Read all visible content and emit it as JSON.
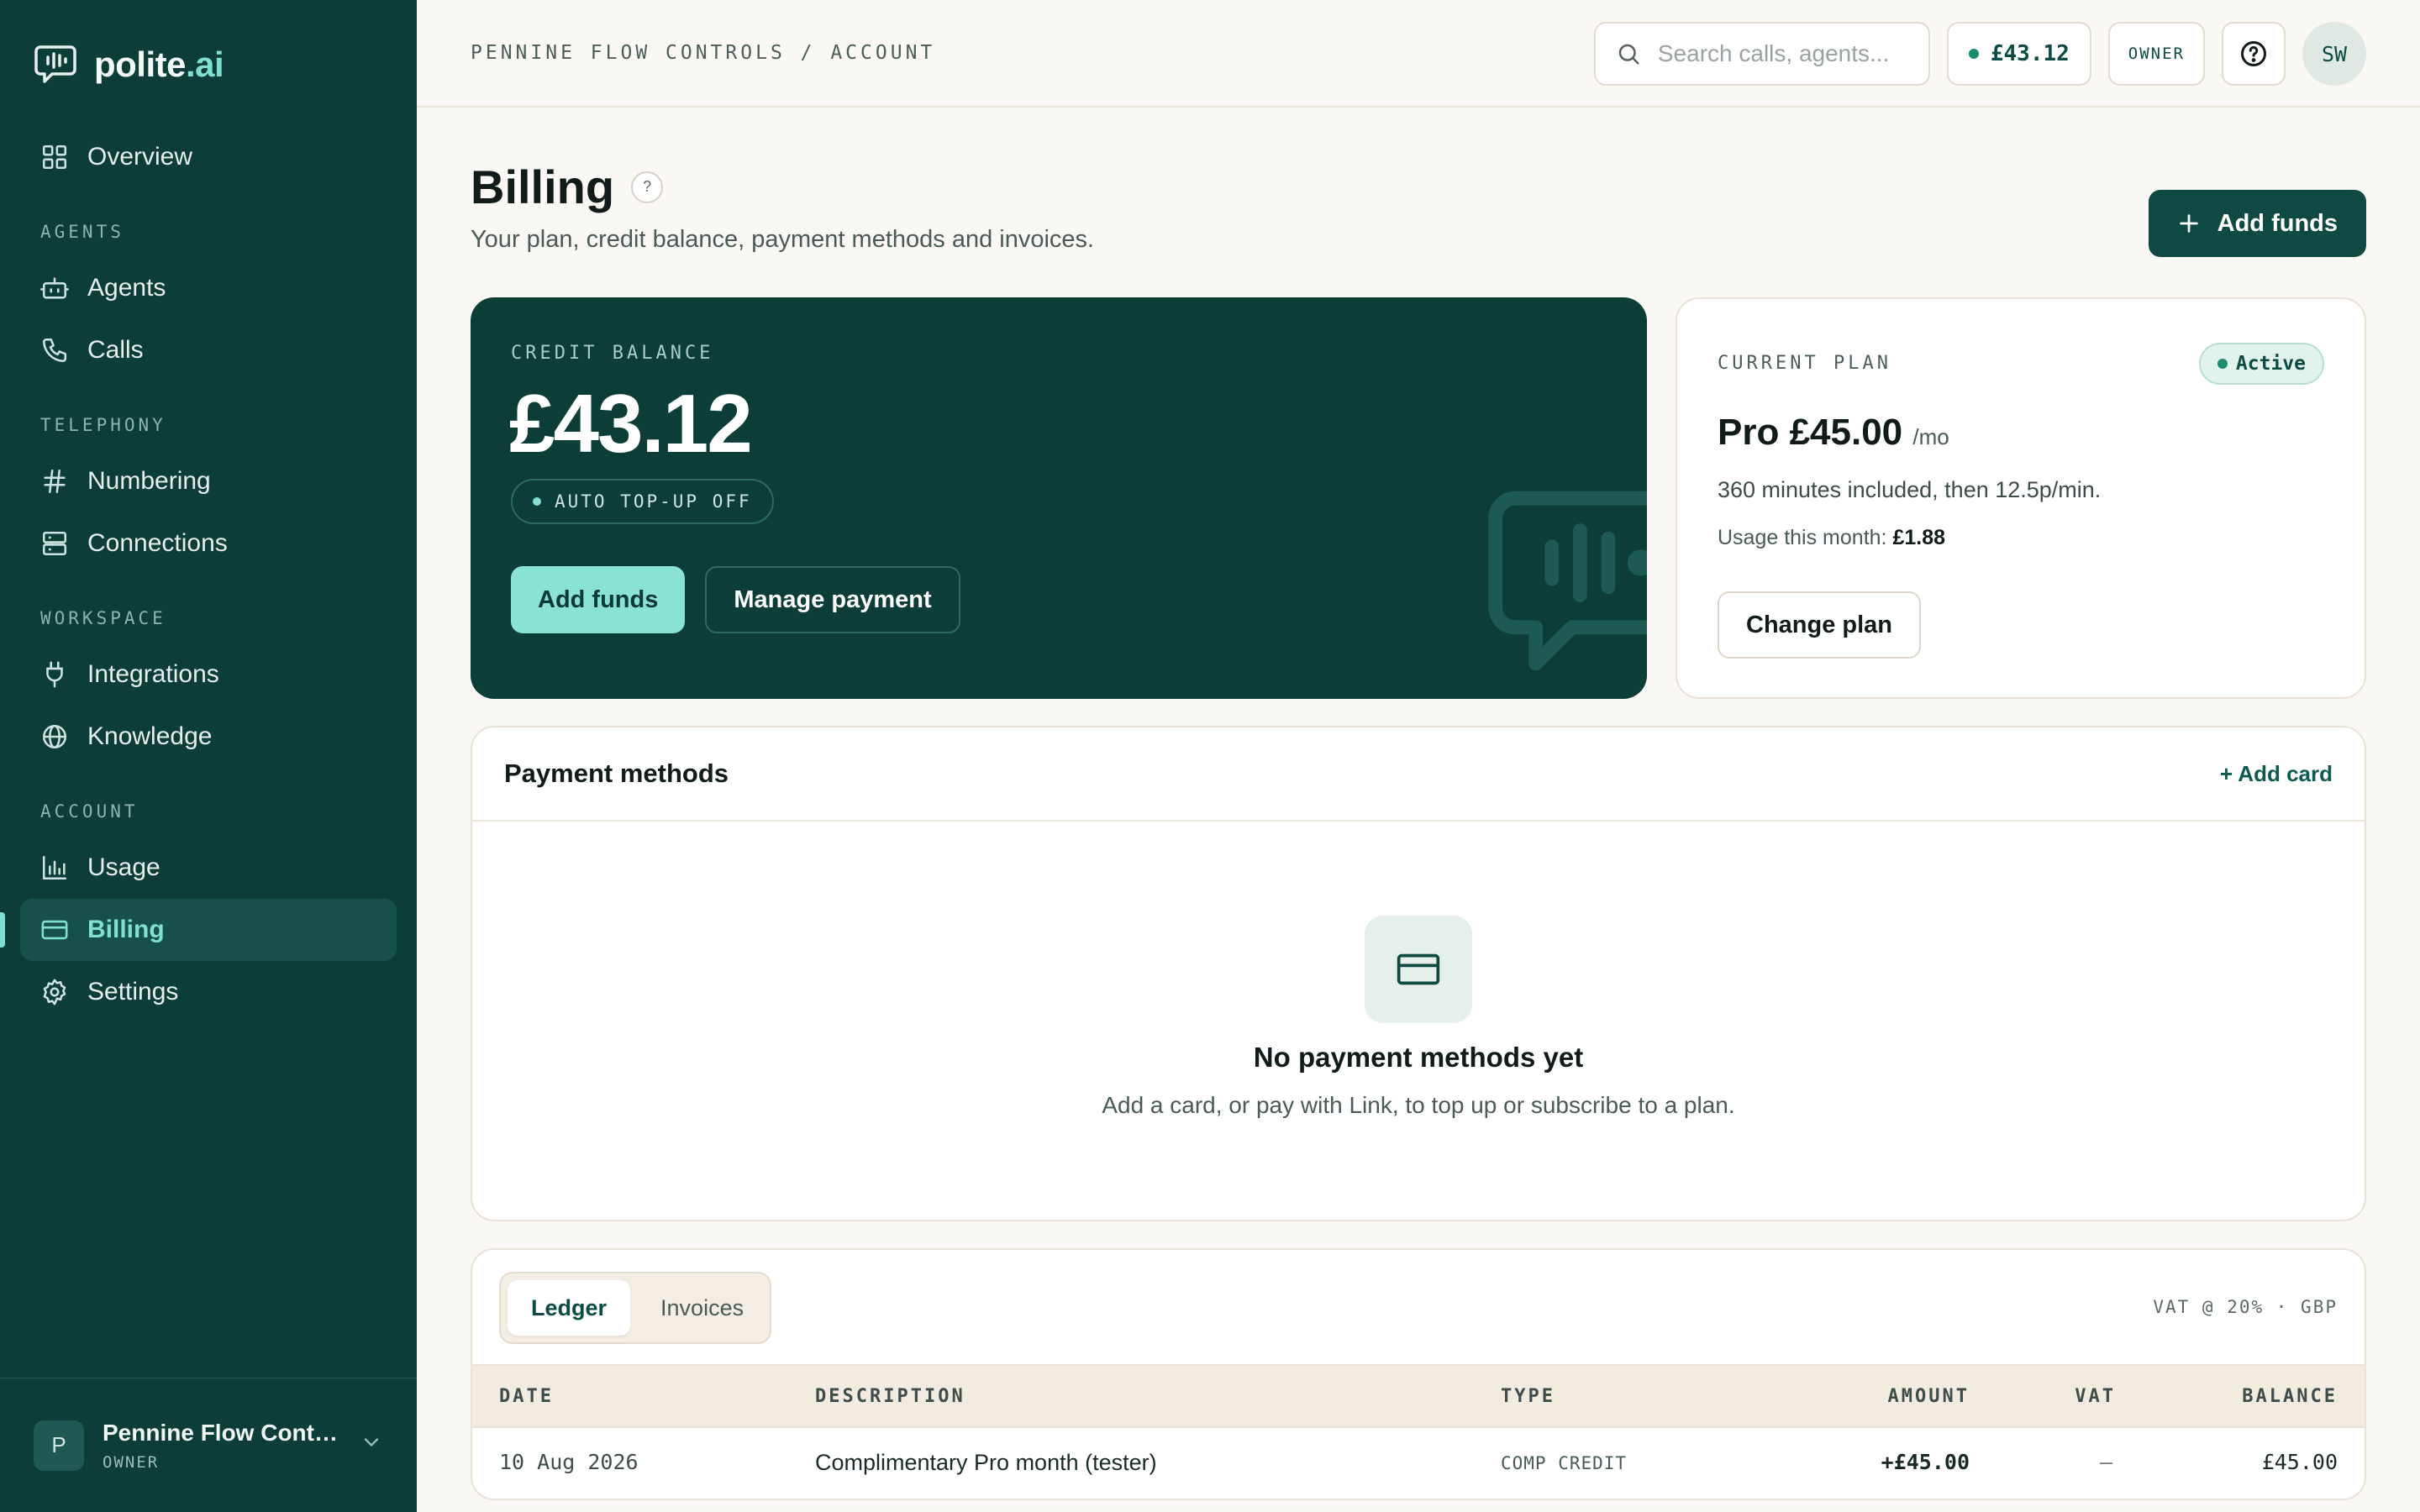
{
  "app": {
    "logo_main": "polite",
    "logo_accent": ".ai"
  },
  "sidebar": {
    "overview": "Overview",
    "sections": {
      "agents": "AGENTS",
      "telephony": "TELEPHONY",
      "workspace": "WORKSPACE",
      "account": "ACCOUNT"
    },
    "items": {
      "agents": "Agents",
      "calls": "Calls",
      "numbering": "Numbering",
      "connections": "Connections",
      "integrations": "Integrations",
      "knowledge": "Knowledge",
      "usage": "Usage",
      "billing": "Billing",
      "settings": "Settings"
    },
    "active_item": "billing",
    "org": {
      "initial": "P",
      "name": "Pennine Flow Contr...",
      "role": "OWNER"
    }
  },
  "topbar": {
    "breadcrumb": "PENNINE FLOW CONTROLS / ACCOUNT",
    "search_placeholder": "Search calls, agents...",
    "balance": "£43.12",
    "role": "OWNER",
    "user_initials": "SW"
  },
  "page": {
    "title": "Billing",
    "help_glyph": "?",
    "subtitle": "Your plan, credit balance, payment methods and invoices.",
    "add_funds": "Add funds"
  },
  "credit": {
    "label": "CREDIT BALANCE",
    "amount": "£43.12",
    "auto_topup": "AUTO TOP-UP OFF",
    "add_funds": "Add funds",
    "manage_payment": "Manage payment"
  },
  "plan": {
    "label": "CURRENT PLAN",
    "status": "Active",
    "name_price": "Pro £45.00",
    "period": "/mo",
    "description": "360 minutes included, then 12.5p/min.",
    "usage_label": "Usage this month:",
    "usage_value": "£1.88",
    "change_plan": "Change plan"
  },
  "payment_methods": {
    "title": "Payment methods",
    "add_card": "+ Add card",
    "empty_title": "No payment methods yet",
    "empty_text": "Add a card, or pay with Link, to top up or subscribe to a plan."
  },
  "ledger": {
    "tabs": [
      "Ledger",
      "Invoices"
    ],
    "active_tab": 0,
    "vat_note": "VAT @ 20% · GBP",
    "columns": {
      "date": "DATE",
      "description": "DESCRIPTION",
      "type": "TYPE",
      "amount": "AMOUNT",
      "vat": "VAT",
      "balance": "BALANCE"
    },
    "rows": [
      {
        "date": "10 Aug 2026",
        "description": "Complimentary Pro month (tester)",
        "type": "COMP CREDIT",
        "amount": "+£45.00",
        "vat": "—",
        "balance": "£45.00"
      }
    ]
  },
  "colors": {
    "sidebar_bg": "#0c3d37",
    "accent_mint": "#8ae3d2",
    "primary_button": "#0e4a42",
    "page_bg": "#faf8f4"
  },
  "icons": {
    "logo": "chat-bubble-waveform-icon",
    "overview": "grid-icon",
    "agents": "robot-icon",
    "calls": "phone-icon",
    "numbering": "hash-icon",
    "connections": "server-icon",
    "integrations": "plug-icon",
    "knowledge": "globe-icon",
    "usage": "bar-chart-icon",
    "billing": "credit-card-icon",
    "settings": "gear-icon"
  }
}
